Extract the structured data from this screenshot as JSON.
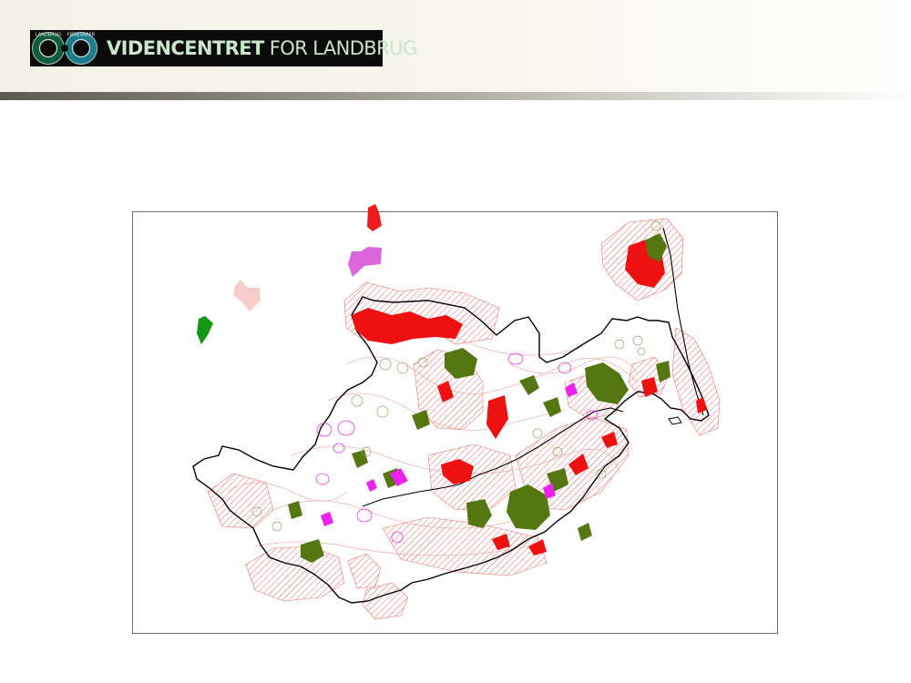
{
  "header": {
    "logo": {
      "brand_strong": "VIDENCENTRET",
      "brand_light": "FOR LANDBRUG",
      "seal_left_text": "LANDBRUG",
      "seal_right_text": "FØDEVARER"
    }
  },
  "map": {
    "legend_swatches": [
      {
        "name": "red",
        "color": "#ee1c1c"
      },
      {
        "name": "magenta",
        "color": "#dd66dd"
      },
      {
        "name": "pink",
        "color": "#f9cccc"
      },
      {
        "name": "green",
        "color": "#119911"
      }
    ],
    "colors": {
      "boundary": "#000000",
      "buffer_hatch": "#ee3333",
      "olive": "#557711",
      "red": "#ee1111",
      "magenta": "#ee22ee"
    }
  }
}
